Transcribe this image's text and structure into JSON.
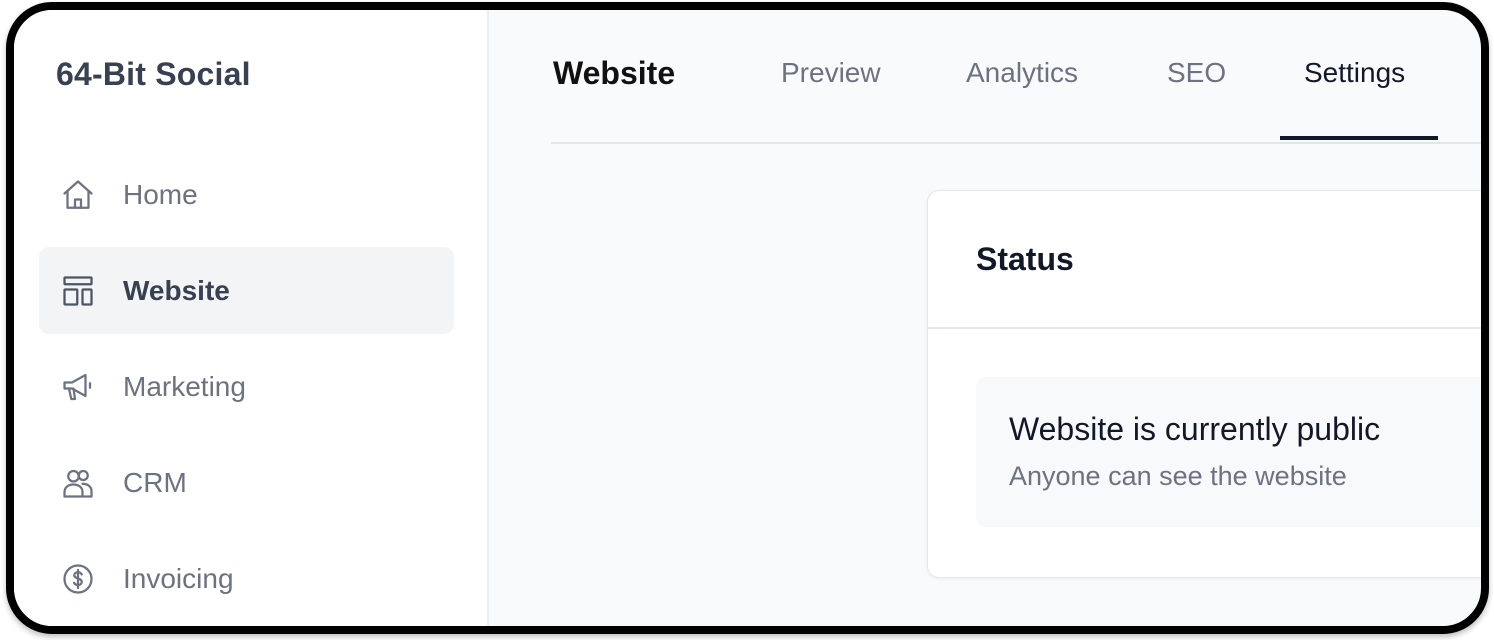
{
  "brand": {
    "name": "64-Bit Social"
  },
  "sidebar": {
    "items": [
      {
        "label": "Home",
        "icon": "home-icon",
        "active": false
      },
      {
        "label": "Website",
        "icon": "layout-icon",
        "active": true
      },
      {
        "label": "Marketing",
        "icon": "megaphone-icon",
        "active": false
      },
      {
        "label": "CRM",
        "icon": "users-icon",
        "active": false
      },
      {
        "label": "Invoicing",
        "icon": "dollar-circle-icon",
        "active": false
      }
    ]
  },
  "header": {
    "title": "Website",
    "tabs": [
      {
        "label": "Preview",
        "active": false
      },
      {
        "label": "Analytics",
        "active": false
      },
      {
        "label": "SEO",
        "active": false
      },
      {
        "label": "Settings",
        "active": true
      }
    ]
  },
  "status_card": {
    "title": "Status",
    "status_title": "Website is currently public",
    "status_description": "Anyone can see the website"
  },
  "colors": {
    "active_tab_underline": "#111827",
    "active_nav_background": "#f3f4f6",
    "muted_text": "#6b7280"
  }
}
